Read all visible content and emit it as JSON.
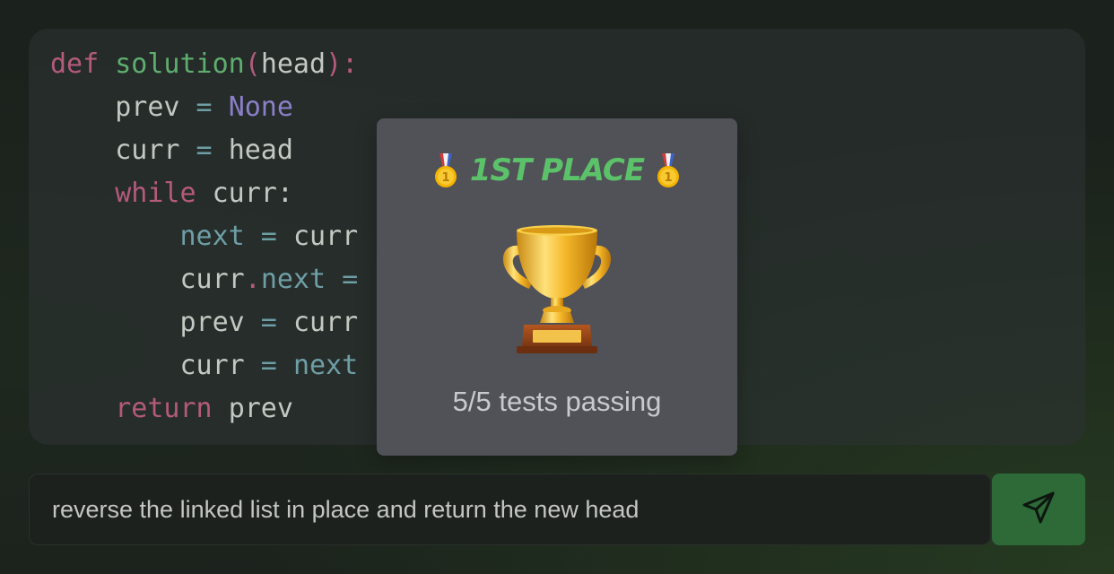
{
  "code": {
    "lines": [
      {
        "tokens": [
          "def",
          " ",
          "solution",
          "(",
          "head",
          "):"
        ]
      },
      {
        "tokens": [
          "    ",
          "prev",
          " = ",
          "None"
        ]
      },
      {
        "tokens": [
          "    ",
          "curr",
          " = ",
          "head"
        ]
      },
      {
        "tokens": [
          "    ",
          "while",
          " ",
          "curr",
          ":"
        ]
      },
      {
        "tokens": [
          "        ",
          "next",
          " = ",
          "curr"
        ]
      },
      {
        "tokens": [
          "        ",
          "curr",
          ".",
          "next",
          " ="
        ]
      },
      {
        "tokens": [
          "        ",
          "prev",
          " = ",
          "curr"
        ]
      },
      {
        "tokens": [
          "        ",
          "curr",
          " = ",
          "next"
        ]
      },
      {
        "tokens": [
          "    ",
          "return",
          " ",
          "prev"
        ]
      }
    ]
  },
  "result": {
    "title": "1ST PLACE",
    "status": "5/5 tests passing",
    "medal_icon": "gold-medal-icon",
    "trophy_icon": "trophy-icon"
  },
  "prompt": {
    "value": "reverse the linked list in place and return the new head",
    "send_icon": "send-icon"
  },
  "colors": {
    "accent": "#5bc26a",
    "send_button": "#2d6a37",
    "card": "#515158"
  }
}
